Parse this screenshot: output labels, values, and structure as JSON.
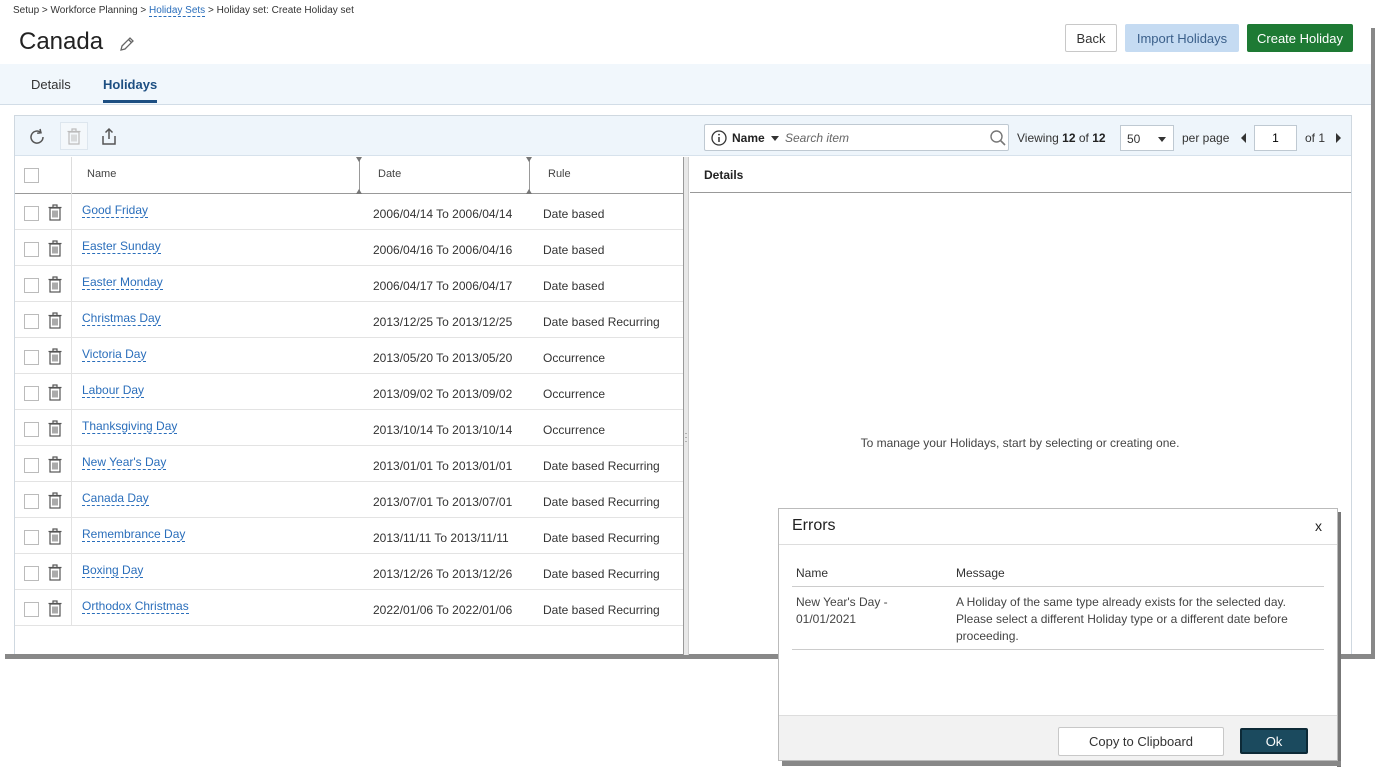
{
  "breadcrumb": {
    "setup": "Setup",
    "workforce": "Workforce Planning",
    "holiday_sets": "Holiday Sets",
    "current": "Holiday set: Create Holiday set",
    "separator": ">"
  },
  "header": {
    "title": "Canada",
    "back_label": "Back",
    "import_label": "Import Holidays",
    "create_label": "Create Holiday"
  },
  "tabs": [
    {
      "label": "Details",
      "active": false
    },
    {
      "label": "Holidays",
      "active": true
    }
  ],
  "toolbar": {
    "icons": [
      "refresh-icon",
      "trash-icon",
      "export-icon"
    ],
    "search_field": "Name",
    "search_placeholder": "Search item",
    "viewing_label": "Viewing",
    "viewing_count": "12",
    "viewing_of": "of",
    "viewing_total": "12",
    "per_page_value": "50",
    "per_page_label": "per page",
    "page_value": "1",
    "page_of": "of 1"
  },
  "grid": {
    "columns": {
      "name": "Name",
      "date": "Date",
      "rule": "Rule"
    },
    "rows": [
      {
        "name": "Good Friday",
        "date": "2006/04/14 To 2006/04/14",
        "rule": "Date based"
      },
      {
        "name": "Easter Sunday",
        "date": "2006/04/16 To 2006/04/16",
        "rule": "Date based"
      },
      {
        "name": "Easter Monday",
        "date": "2006/04/17 To 2006/04/17",
        "rule": "Date based"
      },
      {
        "name": "Christmas Day",
        "date": "2013/12/25 To 2013/12/25",
        "rule": "Date based Recurring"
      },
      {
        "name": "Victoria Day",
        "date": "2013/05/20 To 2013/05/20",
        "rule": "Occurrence"
      },
      {
        "name": "Labour Day",
        "date": "2013/09/02 To 2013/09/02",
        "rule": "Occurrence"
      },
      {
        "name": "Thanksgiving Day",
        "date": "2013/10/14 To 2013/10/14",
        "rule": "Occurrence"
      },
      {
        "name": "New Year's Day",
        "date": "2013/01/01 To 2013/01/01",
        "rule": "Date based Recurring"
      },
      {
        "name": "Canada Day",
        "date": "2013/07/01 To 2013/07/01",
        "rule": "Date based Recurring"
      },
      {
        "name": "Remembrance Day",
        "date": "2013/11/11 To 2013/11/11",
        "rule": "Date based Recurring"
      },
      {
        "name": "Boxing Day",
        "date": "2013/12/26 To 2013/12/26",
        "rule": "Date based Recurring"
      },
      {
        "name": "Orthodox Christmas",
        "date": "2022/01/06 To 2022/01/06",
        "rule": "Date based Recurring"
      }
    ]
  },
  "details": {
    "title": "Details",
    "empty_message": "To manage your Holidays, start by selecting or creating one."
  },
  "errors_dialog": {
    "title": "Errors",
    "close_label": "x",
    "col_name": "Name",
    "col_message": "Message",
    "rows": [
      {
        "name": "New Year's Day - 01/01/2021",
        "message": "A Holiday of the same type already exists for the selected day. Please select a different Holiday type or a different date before proceeding."
      }
    ],
    "copy_label": "Copy to Clipboard",
    "ok_label": "Ok"
  },
  "colors": {
    "primary_green": "#1e7a34",
    "import_blue": "#c5dbf2",
    "link_blue": "#2a6ebb",
    "tab_active": "#1d4f82",
    "ok_button": "#1b4a5e"
  }
}
